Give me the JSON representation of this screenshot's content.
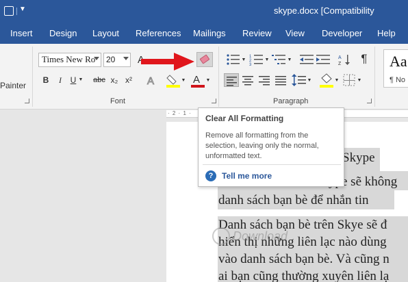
{
  "window": {
    "title": "skype.docx [Compatibility"
  },
  "tabs": [
    "Insert",
    "Design",
    "Layout",
    "References",
    "Mailings",
    "Review",
    "View",
    "Developer",
    "Help"
  ],
  "ribbon": {
    "clipboard_fragment": "Painter",
    "font": {
      "name": "Times New Ro",
      "size": "20",
      "grow_label": "A",
      "bold": "B",
      "italic": "I",
      "underline": "U",
      "strikethrough": "abc",
      "subscript": "x₂",
      "superscript": "x²",
      "group_label": "Font"
    },
    "paragraph": {
      "group_label": "Paragraph",
      "pilcrow": "¶"
    },
    "styles": {
      "preview": "Aa",
      "name": "¶ No"
    }
  },
  "ruler": {
    "text": "· 2 · 1 ·"
  },
  "tooltip": {
    "title": "Clear All Formatting",
    "description": "Remove all formatting from the selection, leaving only the normal, unformatted text.",
    "link": "Tell me more"
  },
  "document": {
    "lines": [
      "Skype",
      "ype sẽ không",
      "danh sách bạn bè để nhắn tin",
      "Danh sách bạn bè trên Skye sẽ đ",
      "hiển thị những liên lạc nào dùng",
      "vào danh sách bạn bè. Và cũng n",
      "ai bạn cũng thường xuyên liên lạ"
    ]
  },
  "watermark": {
    "text": "Download"
  },
  "colors": {
    "accent": "#2b579a",
    "arrow": "#e0161c",
    "highlight": "#ffff00",
    "font_color": "#d0141b"
  }
}
